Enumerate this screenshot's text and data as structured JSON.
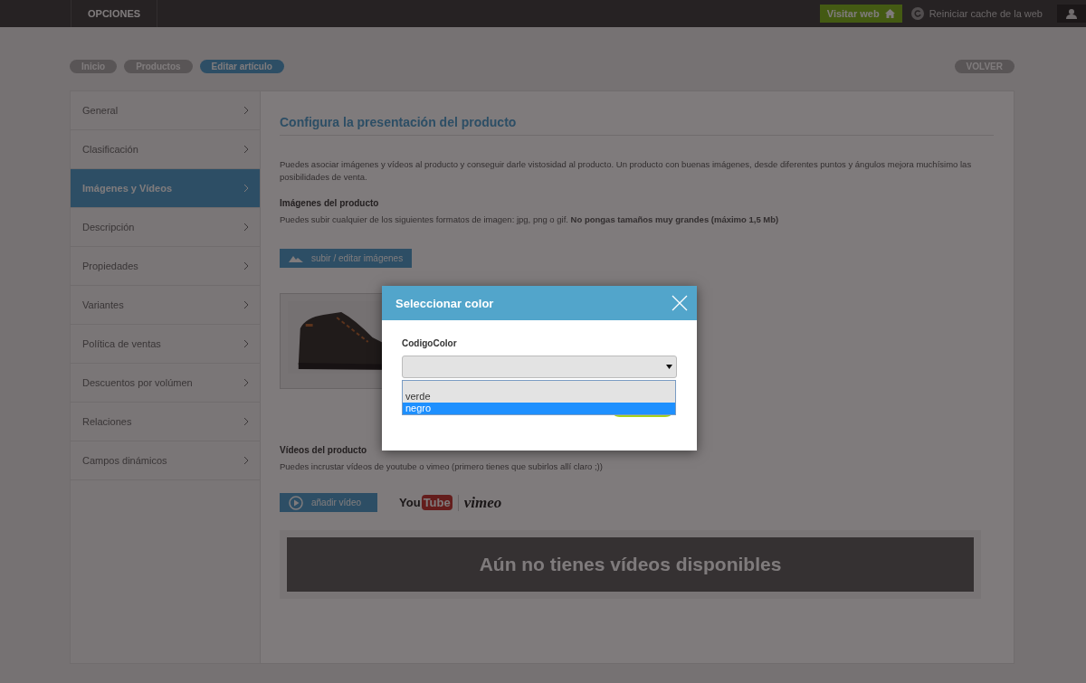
{
  "top_bar": {
    "menu_label": "OPCIONES",
    "visit_button": "Visitar web",
    "cache_link": "Reiniciar cache de la web"
  },
  "breadcrumbs": [
    {
      "label": "Inicio",
      "selected": false
    },
    {
      "label": "Productos",
      "selected": false
    },
    {
      "label": "Editar artículo",
      "selected": true
    }
  ],
  "back_button": "VOLVER",
  "sidebar": {
    "items": [
      {
        "label": "General",
        "selected": false
      },
      {
        "label": "Clasificación",
        "selected": false
      },
      {
        "label": "Imágenes y Vídeos",
        "selected": true
      },
      {
        "label": "Descripción",
        "selected": false
      },
      {
        "label": "Propiedades",
        "selected": false
      },
      {
        "label": "Variantes",
        "selected": false
      },
      {
        "label": "Política de ventas",
        "selected": false
      },
      {
        "label": "Descuentos por volúmen",
        "selected": false
      },
      {
        "label": "Relaciones",
        "selected": false
      },
      {
        "label": "Campos dinámicos",
        "selected": false
      }
    ]
  },
  "content": {
    "title": "Configura la presentación del producto",
    "intro": "Puedes asociar imágenes y vídeos al producto y conseguir darle vistosidad al producto. Un producto con buenas imágenes, desde diferentes puntos y ángulos mejora muchísimo las posibilidades de venta.",
    "images_section": {
      "heading": "Imágenes del producto",
      "description": "Puedes subir cualquier de los siguientes formatos de imagen: jpg, png o gif. **No pongas tamaños muy grandes (máximo 1,5 Mb)**",
      "upload_button": "subir / editar imágenes"
    },
    "videos_section": {
      "heading": "Vídeos del producto",
      "description": "Puedes incrustar vídeos de youtube o vimeo (primero tienes que subirlos allí claro ;))",
      "add_button": "añadir vídeo",
      "youtube_logo": {
        "part_1": "You",
        "part_2": "Tube"
      },
      "vimeo_logo": "vimeo",
      "empty_message": "Aún no tienes vídeos disponibles"
    }
  },
  "dialog": {
    "title": "Seleccionar color",
    "field_label": "CodigoColor",
    "options": [
      {
        "label": "verde",
        "selected": false
      },
      {
        "label": "negro",
        "selected": true
      }
    ]
  }
}
